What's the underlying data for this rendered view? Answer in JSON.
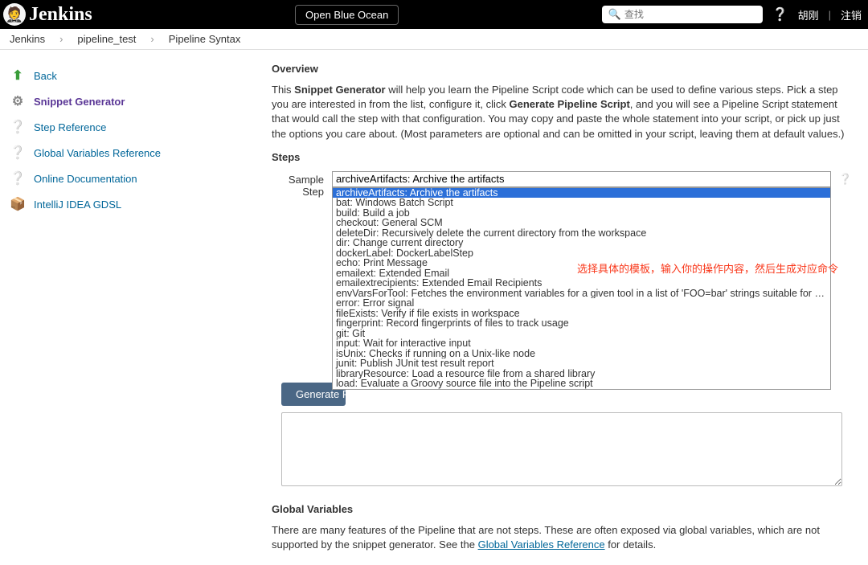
{
  "header": {
    "brand": "Jenkins",
    "blue_ocean": "Open Blue Ocean",
    "search_placeholder": "查找",
    "user": "胡刚",
    "logout": "注销"
  },
  "breadcrumb": {
    "items": [
      "Jenkins",
      "pipeline_test",
      "Pipeline Syntax"
    ]
  },
  "sidebar": {
    "items": [
      {
        "label": "Back",
        "icon": "arrow-up"
      },
      {
        "label": "Snippet Generator",
        "icon": "gear",
        "active": true
      },
      {
        "label": "Step Reference",
        "icon": "help"
      },
      {
        "label": "Global Variables Reference",
        "icon": "help"
      },
      {
        "label": "Online Documentation",
        "icon": "help"
      },
      {
        "label": "IntelliJ IDEA GDSL",
        "icon": "package"
      }
    ]
  },
  "main": {
    "overview_title": "Overview",
    "intro_prefix": "This ",
    "intro_bold1": "Snippet Generator",
    "intro_mid": " will help you learn the Pipeline Script code which can be used to define various steps. Pick a step you are interested in from the list, configure it, click ",
    "intro_bold2": "Generate Pipeline Script",
    "intro_suffix": ", and you will see a Pipeline Script statement that would call the step with that configuration. You may copy and paste the whole statement into your script, or pick up just the options you care about. (Most parameters are optional and can be omitted in your script, leaving them at default values.)",
    "steps_title": "Steps",
    "step_label": "Sample Step",
    "selected_option": "archiveArtifacts: Archive the artifacts",
    "options": [
      "archiveArtifacts: Archive the artifacts",
      "bat: Windows Batch Script",
      "build: Build a job",
      "checkout: General SCM",
      "deleteDir: Recursively delete the current directory from the workspace",
      "dir: Change current directory",
      "dockerLabel: DockerLabelStep",
      "echo: Print Message",
      "emailext: Extended Email",
      "emailextrecipients: Extended Email Recipients",
      "envVarsForTool: Fetches the environment variables for a given tool in a list of 'FOO=bar' strings suitable for the withEnv step.",
      "error: Error signal",
      "fileExists: Verify if file exists in workspace",
      "fingerprint: Record fingerprints of files to track usage",
      "git: Git",
      "input: Wait for interactive input",
      "isUnix: Checks if running on a Unix-like node",
      "junit: Publish JUnit test result report",
      "libraryResource: Load a resource file from a shared library",
      "load: Evaluate a Groovy source file into the Pipeline script"
    ],
    "annotation": "选择具体的模板，输入你的操作内容，然后生成对应命令",
    "generate_btn": "Generate Pipeline Script",
    "gv_title": "Global Variables",
    "gv_text_prefix": "There are many features of the Pipeline that are not steps. These are often exposed via global variables, which are not supported by the snippet generator. See the ",
    "gv_link": "Global Variables Reference",
    "gv_text_suffix": " for details."
  }
}
